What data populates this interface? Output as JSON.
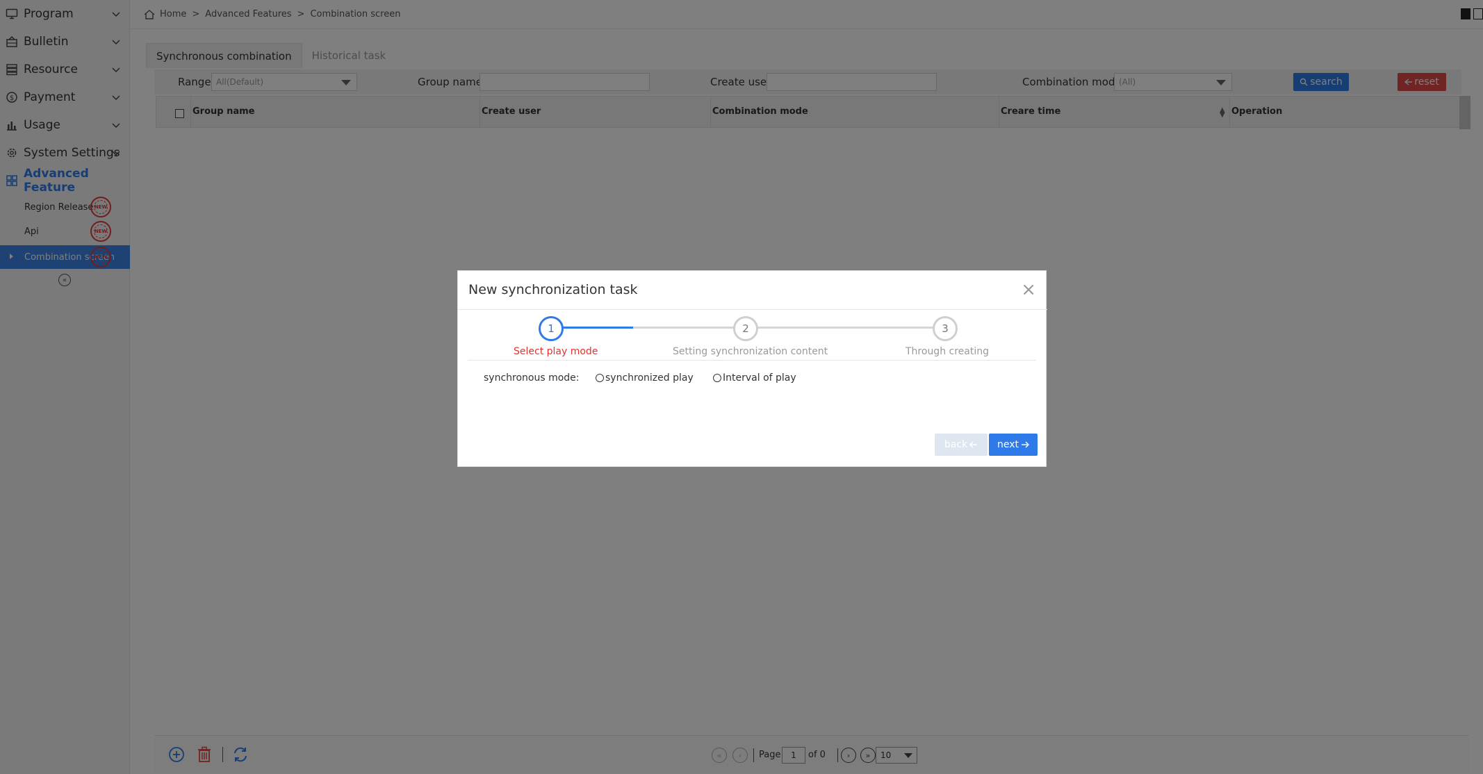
{
  "sidebar": {
    "menu": [
      {
        "label": "Program",
        "icon": "monitor-icon"
      },
      {
        "label": "Bulletin",
        "icon": "bulletin-icon"
      },
      {
        "label": "Resource",
        "icon": "resource-icon"
      },
      {
        "label": "Payment",
        "icon": "payment-icon"
      },
      {
        "label": "Usage",
        "icon": "chart-icon"
      },
      {
        "label": "System Settings",
        "icon": "gear-icon"
      },
      {
        "label": "Advanced Feature",
        "icon": "grid-icon"
      }
    ],
    "sub_items": [
      {
        "label": "Region Release"
      },
      {
        "label": "Api"
      },
      {
        "label": "Combination screen"
      }
    ]
  },
  "breadcrumb": {
    "home": "Home",
    "level1": "Advanced Features",
    "level2": "Combination screen",
    "separator": ">"
  },
  "tabs": [
    "Synchronous combination",
    "Historical task"
  ],
  "filters": {
    "range_label": "Range",
    "range_value": "All(Default)",
    "group_name_label": "Group name",
    "create_user_label": "Create user",
    "combination_mode_label": "Combination mode",
    "combination_mode_value": "(All)",
    "search_label": "search",
    "reset_label": "reset"
  },
  "table": {
    "columns": [
      "Group name",
      "Create user",
      "Combination mode",
      "Creare time",
      "Operation"
    ]
  },
  "pagination": {
    "page_label": "Page",
    "page_value": "1",
    "of_label": "of 0",
    "page_size": "10"
  },
  "modal": {
    "title": "New synchronization task",
    "close": "×",
    "steps": [
      {
        "number": "1",
        "label": "Select play mode"
      },
      {
        "number": "2",
        "label": "Setting synchronization content"
      },
      {
        "number": "3",
        "label": "Through creating"
      }
    ],
    "mode_label": "synchronous mode:",
    "options": [
      "synchronized play",
      "Interval of play"
    ],
    "back_label": "back",
    "next_label": "next"
  },
  "colors": {
    "accent": "#2d7ae8",
    "danger": "#e04848",
    "active_step_label": "#e8302b"
  }
}
